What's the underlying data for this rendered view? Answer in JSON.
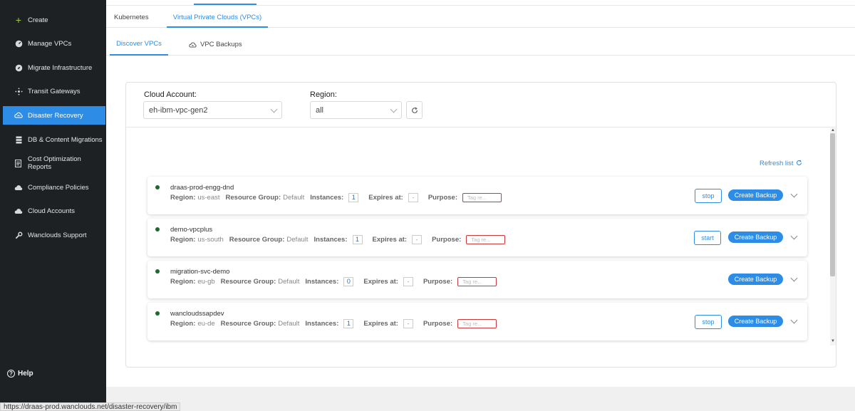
{
  "sidebar": {
    "items": [
      {
        "label": "Create",
        "icon": "plus-icon"
      },
      {
        "label": "Manage VPCs",
        "icon": "gauge-icon"
      },
      {
        "label": "Migrate Infrastructure",
        "icon": "compass-icon"
      },
      {
        "label": "Transit Gateways",
        "icon": "network-icon"
      },
      {
        "label": "Disaster Recovery",
        "icon": "cloud-sync-icon",
        "active": true
      },
      {
        "label": "DB & Content Migrations",
        "icon": "database-icon"
      },
      {
        "label": "Cost Optimization Reports",
        "icon": "document-icon"
      },
      {
        "label": "Compliance Policies",
        "icon": "cloud-icon"
      },
      {
        "label": "Cloud Accounts",
        "icon": "cloud-icon"
      },
      {
        "label": "Wanclouds Support",
        "icon": "wrench-icon"
      }
    ],
    "help_label": "Help"
  },
  "tabs_primary": [
    {
      "label": "Kubernetes"
    },
    {
      "label": "Virtual Private Clouds (VPCs)",
      "active": true
    }
  ],
  "tabs_secondary": [
    {
      "label": "Discover VPCs",
      "active": true
    },
    {
      "label": "VPC Backups"
    }
  ],
  "filters": {
    "cloud_account_label": "Cloud Account:",
    "cloud_account_value": "eh-ibm-vpc-gen2",
    "region_label": "Region:",
    "region_value": "all"
  },
  "refresh_list_label": "Refresh list",
  "vpc_labels": {
    "region": "Region:",
    "resource_group": "Resource Group:",
    "instances": "Instances:",
    "expires_at": "Expires at:",
    "purpose": "Purpose:",
    "tag_placeholder": "Tag re...",
    "create_backup": "Create Backup"
  },
  "vpcs": [
    {
      "name": "draas-prod-engg-dnd",
      "region": "us-east",
      "resource_group": "Default",
      "instances": "1",
      "expires_at": "-",
      "action": "stop"
    },
    {
      "name": "demo-vpcplus",
      "region": "us-south",
      "resource_group": "Default",
      "instances": "1",
      "expires_at": "-",
      "action": "start"
    },
    {
      "name": "migration-svc-demo",
      "region": "eu-gb",
      "resource_group": "Default",
      "instances": "0",
      "expires_at": "-",
      "action": ""
    },
    {
      "name": "wancloudssapdev",
      "region": "eu-de",
      "resource_group": "Default",
      "instances": "1",
      "expires_at": "-",
      "action": "stop"
    }
  ],
  "status_bar_url": "https://draas-prod.wanclouds.net/disaster-recovery/ibm",
  "colors": {
    "accent": "#2d8ce6",
    "sidebar": "#1e2124",
    "status_dot": "#1c6b2c",
    "tag_border": "#c93b3b"
  }
}
